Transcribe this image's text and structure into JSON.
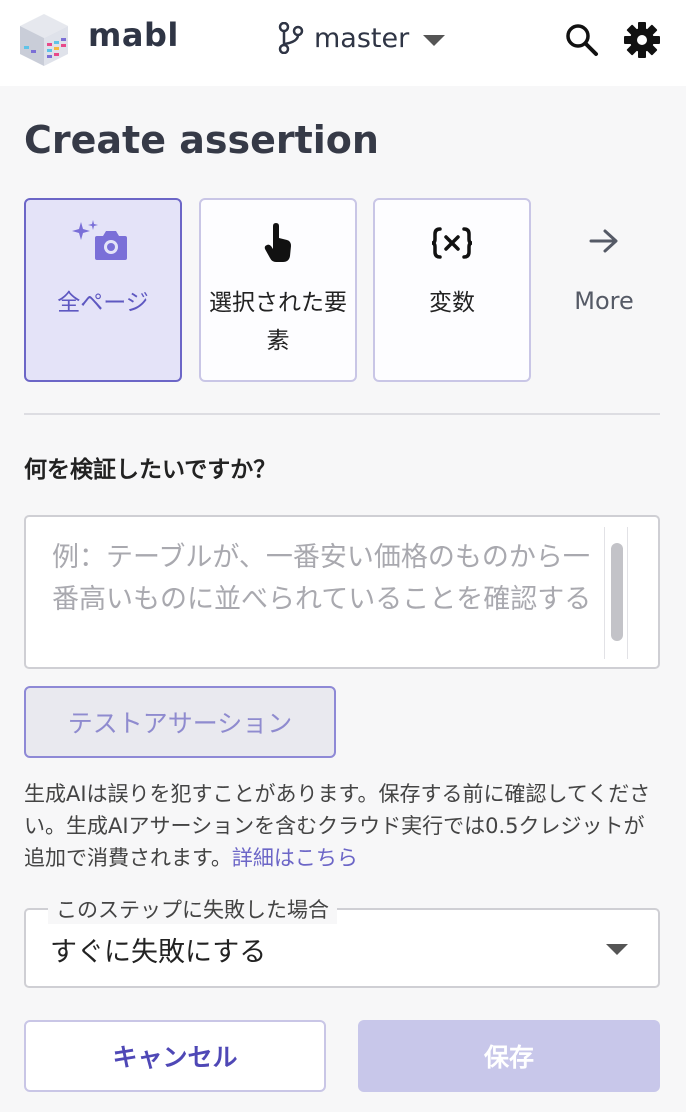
{
  "header": {
    "brand": "mabl",
    "branch": "master",
    "icons": {
      "branch": "git-branch-icon",
      "search": "search-icon",
      "settings": "gear-icon"
    }
  },
  "title": "Create assertion",
  "assertion_types": [
    {
      "label": "全ページ",
      "icon": "sparkle-camera-icon",
      "selected": true
    },
    {
      "label": "選択された要素",
      "icon": "pointer-hand-icon",
      "selected": false
    },
    {
      "label": "変数",
      "icon": "variable-braces-icon",
      "selected": false
    }
  ],
  "more": {
    "label": "More",
    "icon": "arrow-right-icon"
  },
  "question": "何を検証したいですか？",
  "prompt": {
    "value": "",
    "placeholder": "例：テーブルが、一番安い価格のものから一番高いものに並べられていることを確認する"
  },
  "test_button": "テストアサーション",
  "notice": {
    "text": "生成AIは誤りを犯すことがあります。保存する前に確認してください。生成AIアサーションを含むクラウド実行では0.5クレジットが追加で消費されます。",
    "link": "詳細はこちら"
  },
  "failure": {
    "legend": "このステップに失敗した場合",
    "value": "すぐに失敗にする"
  },
  "actions": {
    "cancel": "キャンセル",
    "save": "保存"
  },
  "colors": {
    "accent": "#6c66c7",
    "selected_bg": "#e4e3f8",
    "save_disabled": "#c8c7ea"
  }
}
